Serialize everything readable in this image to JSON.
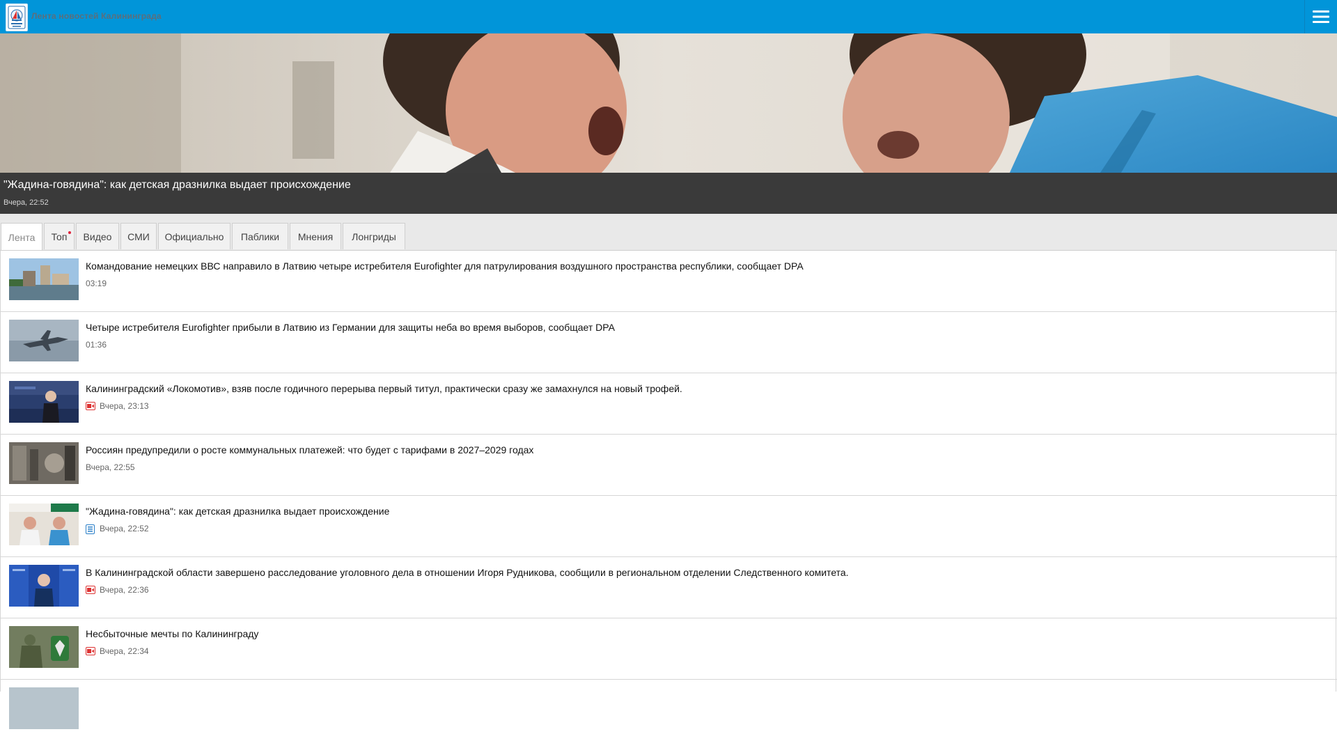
{
  "header": {
    "site_title": "Лента новостей Калининграда",
    "logo_icon": "sailboat-logo-icon",
    "menu_icon": "hamburger-menu-icon",
    "bg_color": "#0195d9"
  },
  "hero": {
    "title": "\"Жадина-говядина\": как детская дразнилка выдает происхождение",
    "time": "Вчера, 22:52"
  },
  "tabs": [
    {
      "label": "Лента",
      "active": true
    },
    {
      "label": "Топ",
      "indicator": "red-dot"
    },
    {
      "label": "Видео"
    },
    {
      "label": "СМИ"
    },
    {
      "label": "Официально"
    },
    {
      "label": "Паблики"
    },
    {
      "label": "Мнения"
    },
    {
      "label": "Лонгриды"
    }
  ],
  "news": [
    {
      "title": "Командование немецких ВВС направило в Латвию четыре истребителя Eurofighter для патрулирования воздушного пространства республики, сообщает DPA",
      "time": "03:19",
      "icon": ""
    },
    {
      "title": "Четыре истребителя Eurofighter прибыли в Латвию из Германии для защиты неба во время выборов, сообщает DPA",
      "time": "01:36",
      "icon": ""
    },
    {
      "title": "Калининградский «Локомотив», взяв после годичного перерыва первый титул, практически сразу же замахнулся на новый трофей.",
      "time": "Вчера, 23:13",
      "icon": "video-icon"
    },
    {
      "title": "Россиян предупредили о росте коммунальных платежей: что будет с тарифами в 2027–2029 годах",
      "time": "Вчера, 22:55",
      "icon": ""
    },
    {
      "title": "\"Жадина-говядина\": как детская дразнилка выдает происхождение",
      "time": "Вчера, 22:52",
      "icon": "article-icon"
    },
    {
      "title": "В Калининградской области завершено расследование уголовного дела в отношении Игоря Рудникова, сообщили в региональном отделении Следственного комитета.",
      "time": "Вчера, 22:36",
      "icon": "video-icon"
    },
    {
      "title": "Несбыточные мечты по Калининграду",
      "time": "Вчера, 22:34",
      "icon": "video-icon"
    }
  ]
}
